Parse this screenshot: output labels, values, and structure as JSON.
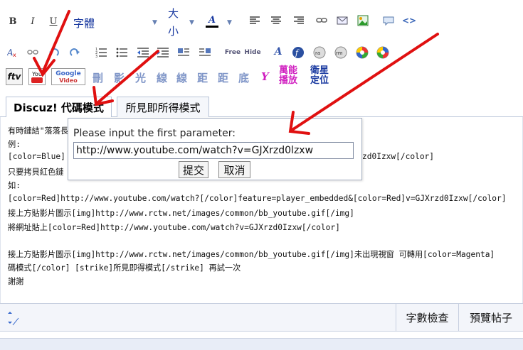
{
  "toolbar": {
    "bold": "B",
    "italic": "I",
    "underline": "U",
    "font_label": "字體",
    "size_label_1": "大",
    "size_label_2": "小",
    "text_color_glyph": "A",
    "free_label": "Free",
    "hide_label": "Hide",
    "google_label_1": "Google",
    "google_label_2": "Video",
    "youtube_label": "You",
    "ftv_label": "ftv",
    "zh_buttons": [
      "刪",
      "影",
      "光",
      "線",
      "線",
      "距",
      "距",
      "底"
    ],
    "y_glyph": "Y",
    "wanneng_1": "萬能",
    "wanneng_2": "播放",
    "satellite_1": "衛星",
    "satellite_2": "定位"
  },
  "tabs": [
    {
      "label": "Discuz! 代碼模式"
    },
    {
      "label": "所見即所得模式"
    }
  ],
  "editor_lines": [
    "有時鏈結\"落落長",
    "例:",
    "[color=Blue]",
    "只要拷貝紅色鏈",
    "如:",
    "[color=Red]http://www.youtube.com/watch?[/color]feature=player_embedded&[color=Red]v=GJXrzd0Izxw[/color]",
    "接上方貼影片圖示[img]http://www.rctw.net/images/common/bb_youtube.gif[/img]",
    "將網址貼上[color=Red]http://www.youtube.com/watch?v=GJXrzd0Izxw[/color]",
    "",
    "接上方貼影片圖示[img]http://www.rctw.net/images/common/bb_youtube.gif[/img]未出現視窗 可轉用[color=Magenta]",
    "碼模式[/color] [strike]所見即得模式[/strike] 再試一次",
    "謝謝"
  ],
  "editor_partial_right": "zd0Izxw[/color]",
  "dialog": {
    "prompt": "Please input the first parameter:",
    "input_value": "http://www.youtube.com/watch?v=GJXrzd0lzxw",
    "submit_label": "提交",
    "cancel_label": "取消"
  },
  "status": {
    "word_count_label": "字數檢查",
    "preview_label": "預覽帖子"
  },
  "colors": {
    "arrow": "#e01010",
    "accent_blue": "#1a3aa0",
    "magenta": "#d01fc0"
  }
}
